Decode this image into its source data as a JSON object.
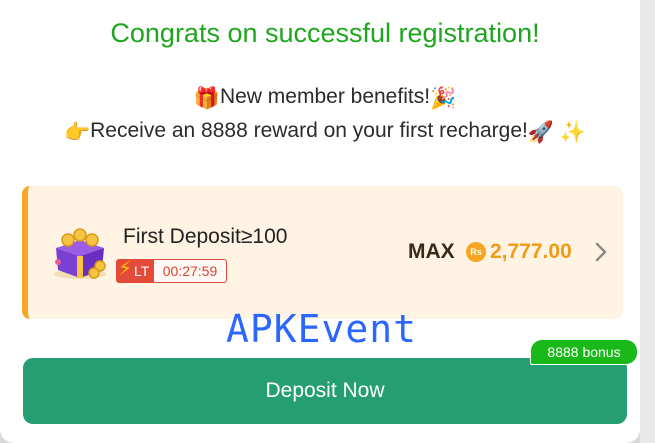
{
  "title": "Congrats on successful registration!",
  "benefits": {
    "line1_prefix_emoji": "🎁",
    "line1_text": "New member benefits!",
    "line1_suffix_emoji": "🎉",
    "line2_prefix_emoji": "👉",
    "line2_text": "Receive an 8888 reward on your first recharge!",
    "line2_suffix_emoji": "🚀 ✨"
  },
  "offer_card": {
    "title": "First Deposit≥100",
    "badge_label": "LT",
    "timer": "00:27:59",
    "max_label": "MAX",
    "currency_symbol": "Rs",
    "max_amount": "2,777.00"
  },
  "watermark": "APKEvent",
  "deposit_button": {
    "label": "Deposit Now",
    "bonus_tag": "8888 bonus"
  },
  "colors": {
    "title_green": "#1ea61e",
    "button_green": "#259f72",
    "card_bg": "#fff3e3",
    "accent_orange": "#f39a14",
    "timer_red": "#e34a38"
  }
}
